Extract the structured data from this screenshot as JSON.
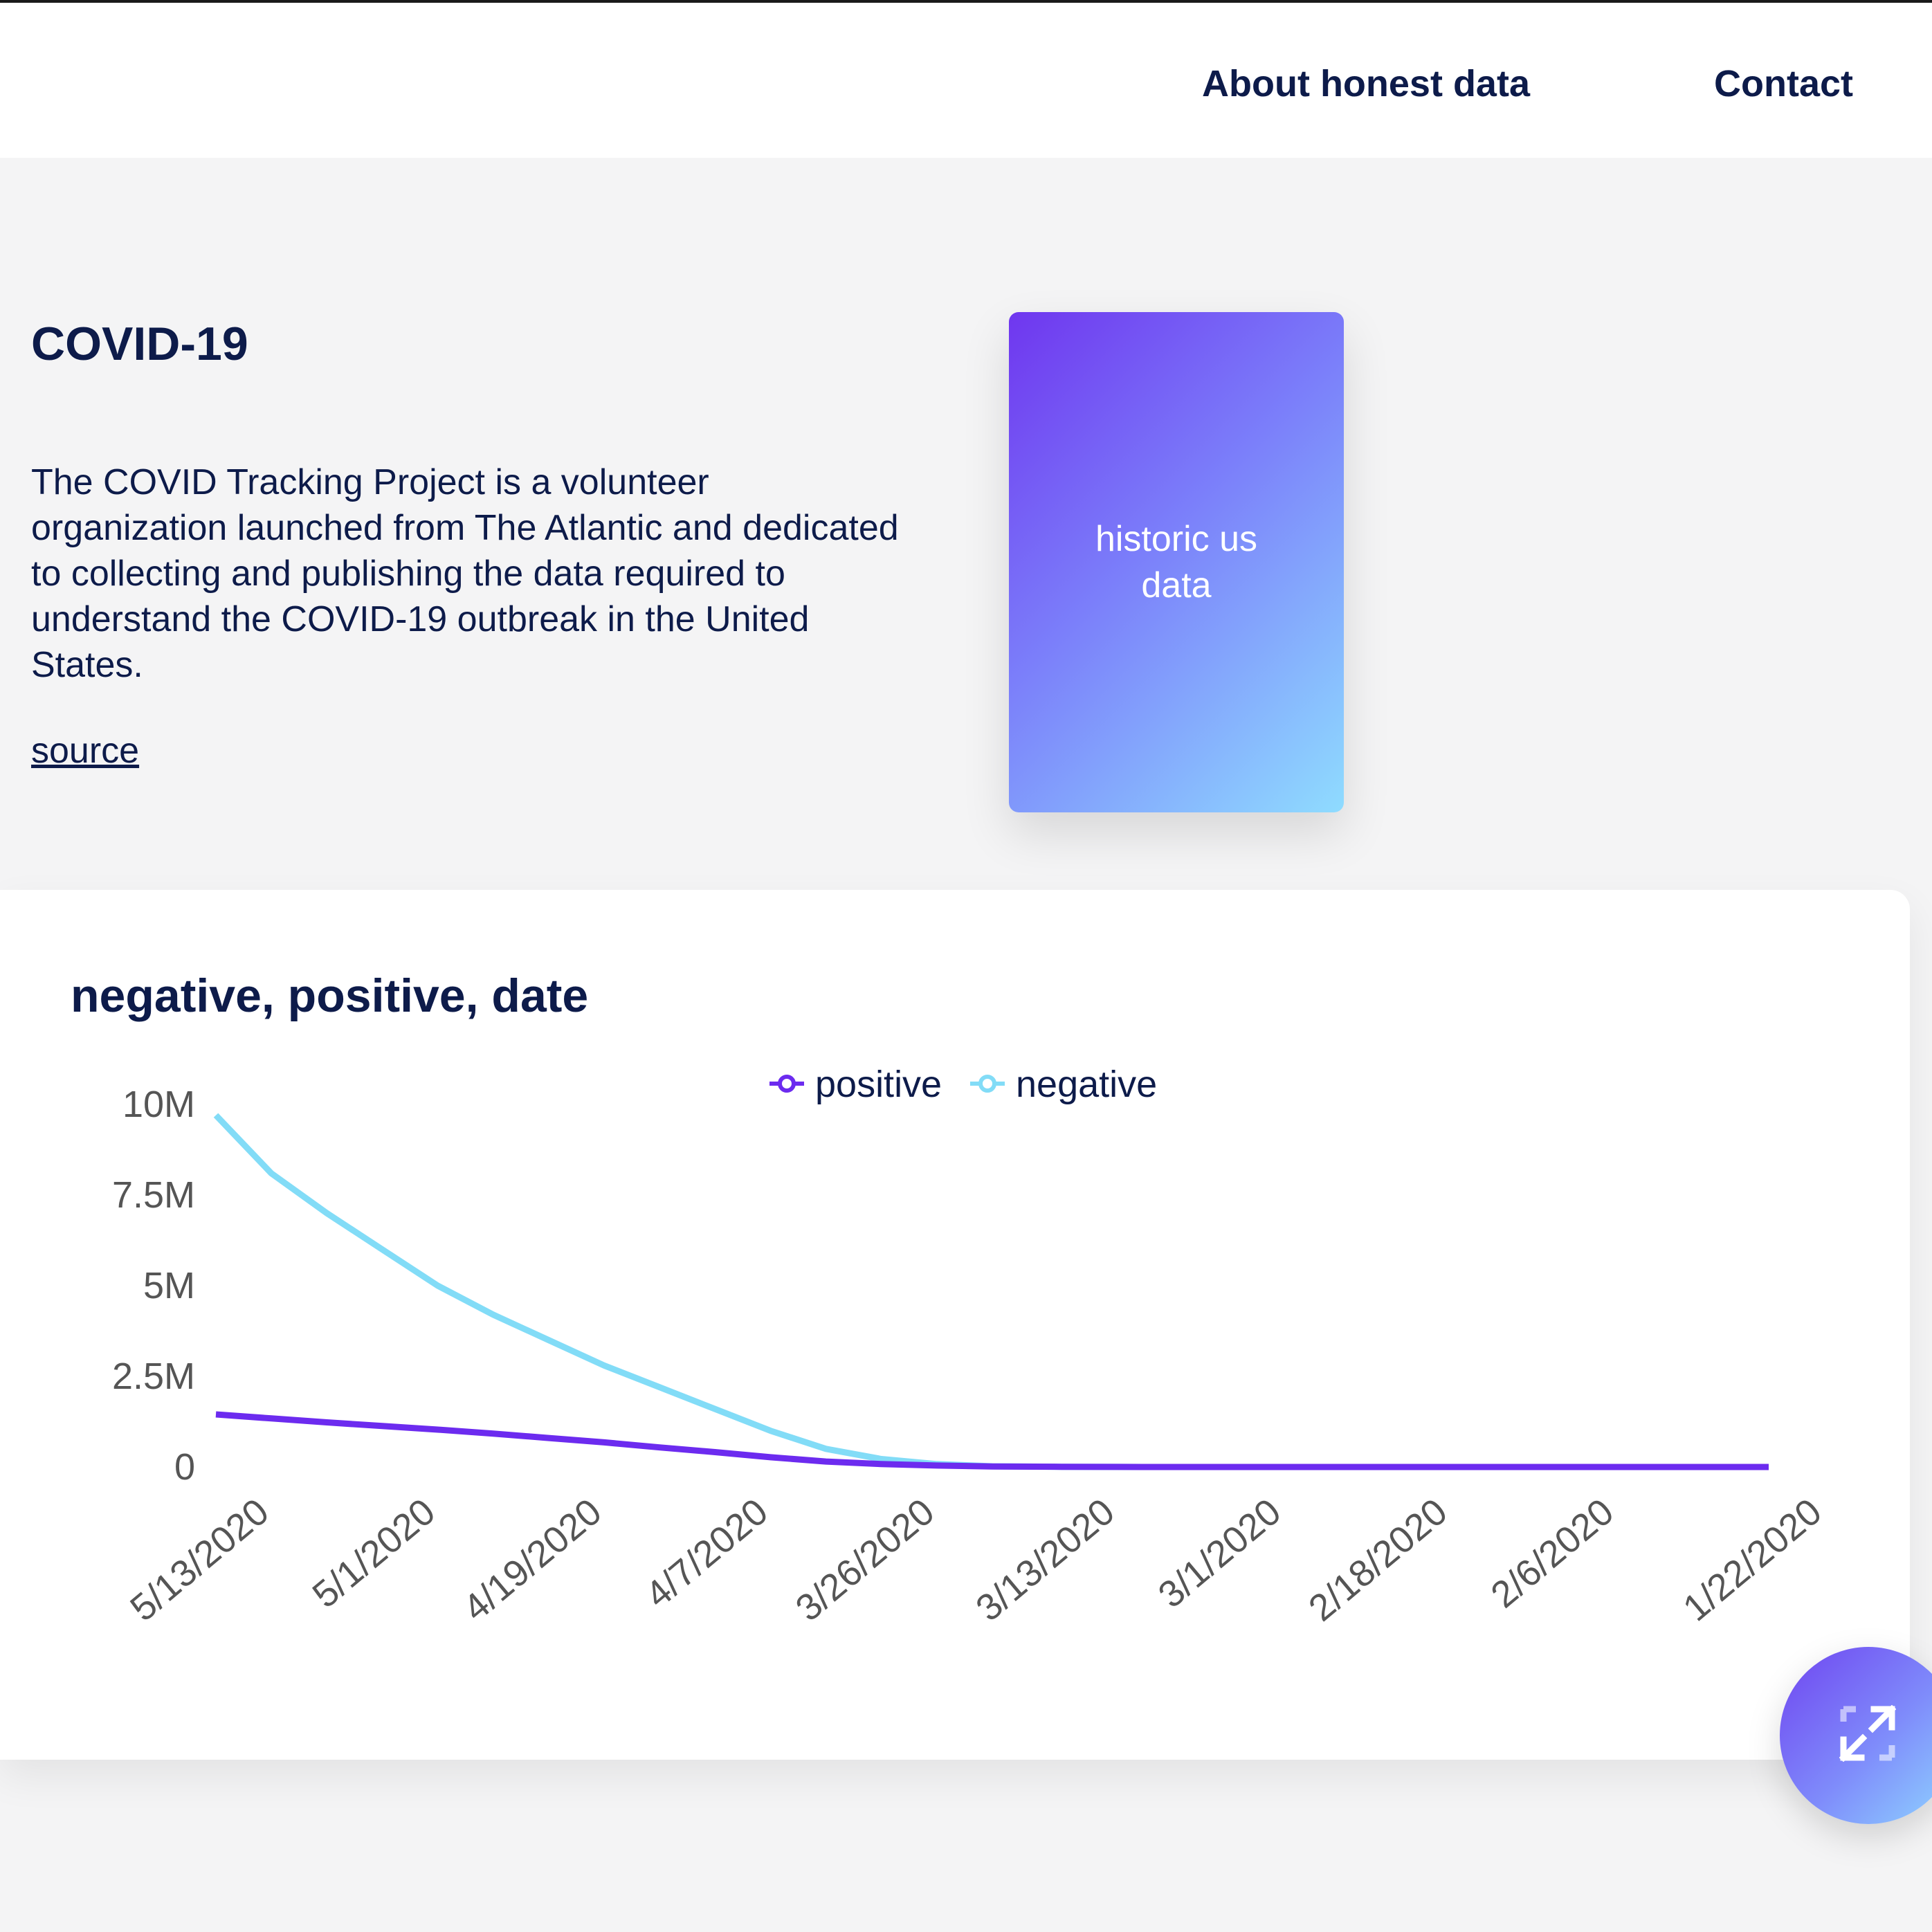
{
  "nav": {
    "about": "About honest data",
    "contact": "Contact"
  },
  "intro": {
    "title": "COVID-19",
    "description": "The COVID Tracking Project is a volunteer organization launched from The Atlantic and dedicated to collecting and publishing the data required to understand the COVID-19 outbreak in the United States.",
    "source_label": "source"
  },
  "dataset_card": {
    "label": "historic us data"
  },
  "colors": {
    "positive": "#6c2bef",
    "negative": "#82dcf7",
    "text": "#0d1b4a",
    "axis_text": "#555555"
  },
  "chart_data": {
    "type": "line",
    "title": "negative, positive, date",
    "legend_position": "top-center",
    "x_tick_labels": [
      "5/13/2020",
      "5/1/2020",
      "4/19/2020",
      "4/7/2020",
      "3/26/2020",
      "3/13/2020",
      "3/1/2020",
      "2/18/2020",
      "2/6/2020",
      "1/22/2020"
    ],
    "y_tick_labels": [
      "10M",
      "7.5M",
      "5M",
      "2.5M",
      "0"
    ],
    "ylim": [
      0,
      10000000
    ],
    "x": [
      "5/13/2020",
      "5/9/2020",
      "5/5/2020",
      "5/1/2020",
      "4/27/2020",
      "4/23/2020",
      "4/19/2020",
      "4/15/2020",
      "4/11/2020",
      "4/7/2020",
      "4/3/2020",
      "3/30/2020",
      "3/26/2020",
      "3/22/2020",
      "3/18/2020",
      "3/13/2020",
      "3/9/2020",
      "3/5/2020",
      "3/1/2020",
      "2/26/2020",
      "2/22/2020",
      "2/18/2020",
      "2/14/2020",
      "2/10/2020",
      "2/6/2020",
      "2/2/2020",
      "1/29/2020",
      "1/25/2020",
      "1/22/2020"
    ],
    "series": [
      {
        "name": "positive",
        "values": [
          1450000,
          1340000,
          1230000,
          1130000,
          1030000,
          920000,
          800000,
          680000,
          540000,
          410000,
          270000,
          150000,
          80000,
          40000,
          15000,
          5000,
          1000,
          300,
          0,
          0,
          0,
          0,
          0,
          0,
          0,
          0,
          0,
          0,
          0
        ]
      },
      {
        "name": "negative",
        "values": [
          9700000,
          8100000,
          7000000,
          6000000,
          5000000,
          4200000,
          3500000,
          2800000,
          2200000,
          1600000,
          1000000,
          500000,
          220000,
          80000,
          20000,
          5000,
          1000,
          300,
          0,
          null,
          null,
          null,
          null,
          null,
          null,
          null,
          null,
          null,
          null
        ]
      }
    ]
  }
}
